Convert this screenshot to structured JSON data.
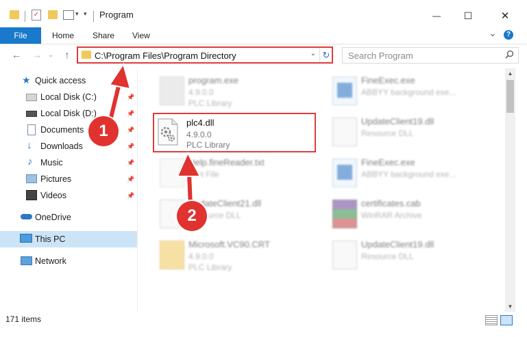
{
  "window": {
    "title": "Program",
    "minimize_label": "—",
    "maximize_label": "☐",
    "close_label": "✕"
  },
  "ribbon": {
    "tabs": [
      "File",
      "Home",
      "Share",
      "View"
    ],
    "expand_label": "⌄",
    "help_label": "?"
  },
  "address": {
    "path": "C:\\Program Files\\Program Directory",
    "dropdown_label": "⌄",
    "refresh_label": "↻"
  },
  "search": {
    "placeholder": "Search Program"
  },
  "sidebar": {
    "items": [
      {
        "label": "Quick access",
        "icon": "star-icon"
      },
      {
        "label": "Local Disk (C:)",
        "icon": "drive-icon",
        "pinned": true
      },
      {
        "label": "Local Disk (D:)",
        "icon": "drive-icon",
        "pinned": true
      },
      {
        "label": "Documents",
        "icon": "documents-icon",
        "pinned": true
      },
      {
        "label": "Downloads",
        "icon": "download-icon",
        "pinned": true
      },
      {
        "label": "Music",
        "icon": "music-icon",
        "pinned": true
      },
      {
        "label": "Pictures",
        "icon": "pictures-icon",
        "pinned": true
      },
      {
        "label": "Videos",
        "icon": "videos-icon",
        "pinned": true
      },
      {
        "label": "OneDrive",
        "icon": "cloud-icon"
      },
      {
        "label": "This PC",
        "icon": "computer-icon",
        "selected": true
      },
      {
        "label": "Network",
        "icon": "network-icon"
      }
    ]
  },
  "files": [
    {
      "name": "program.exe",
      "line1": "4.9.0.0",
      "line2": "PLC Library"
    },
    {
      "name": "FineExec.exe",
      "line1": "ABBYY background exe...",
      "line2": ""
    },
    {
      "name": "plc4.dll",
      "line1": "4.9.0.0",
      "line2": "PLC Library"
    },
    {
      "name": "UpdateClient19.dll",
      "line1": "Resource DLL",
      "line2": ""
    },
    {
      "name": "Help.fineReader.txt",
      "line1": "Text File",
      "line2": ""
    },
    {
      "name": "FineExec.exe",
      "line1": "ABBYY background exe...",
      "line2": ""
    },
    {
      "name": "UpdateClient21.dll",
      "line1": "Resource DLL",
      "line2": ""
    },
    {
      "name": "certificates.cab",
      "line1": "WinRAR Archive",
      "line2": ""
    },
    {
      "name": "Microsoft.VC90.CRT",
      "line1": "4.9.0.0",
      "line2": "PLC Library"
    },
    {
      "name": "UpdateClient19.dll",
      "line1": "Resource DLL",
      "line2": ""
    }
  ],
  "status": {
    "item_count": "171 items"
  },
  "annotations": {
    "step1": "1",
    "step2": "2",
    "color": "#e0322f"
  },
  "colors": {
    "accent": "#1979ca",
    "highlight": "#e03a3a",
    "selection": "#cce4f7"
  }
}
